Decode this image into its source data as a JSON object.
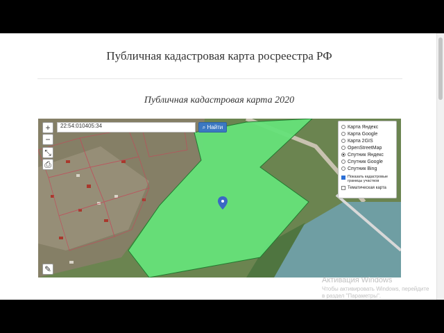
{
  "page": {
    "title": "Публичная кадастровая карта росреестра РФ",
    "subtitle": "Публичная кадастровая карта 2020"
  },
  "map": {
    "search": {
      "value": "22:54:010405:34",
      "button_label": "Найти"
    },
    "zoom_in_label": "+",
    "zoom_out_label": "−",
    "layers": [
      {
        "label": "Карта Яндекс",
        "selected": false
      },
      {
        "label": "Карта Google",
        "selected": false
      },
      {
        "label": "Карта 2GIS",
        "selected": false
      },
      {
        "label": "OpenStreetMap",
        "selected": false
      },
      {
        "label": "Спутник Яндекс",
        "selected": true
      },
      {
        "label": "Спутник Google",
        "selected": false
      },
      {
        "label": "Спутник Bing",
        "selected": false
      }
    ],
    "show_cadastral_label": "Показать кадастровые границы участков",
    "thematic_label": "Тематическая карта",
    "highlight_color": "#66e27a"
  },
  "watermark": {
    "line1": "Активация Windows",
    "line2": "Чтобы активировать Windows, перейдите в раздел \"Параметры\"."
  }
}
